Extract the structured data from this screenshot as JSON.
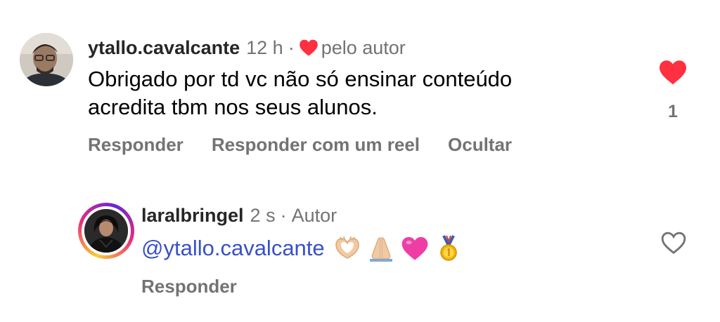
{
  "comment": {
    "username": "ytallo.cavalcante",
    "time": "12 h",
    "separator": "·",
    "liked_by_author_label": "pelo autor",
    "text_line1": "Obrigado por td vc não só ensinar conteúdo",
    "text_line2": "acredita tbm nos seus alunos.",
    "like_count": "1",
    "liked": true,
    "actions": {
      "reply": "Responder",
      "reply_with_reel": "Responder com um reel",
      "hide": "Ocultar"
    }
  },
  "reply": {
    "username": "laralbringel",
    "time": "2 s",
    "separator": "·",
    "badge": "Autor",
    "mention": "@ytallo.cavalcante",
    "emojis": [
      "heart-hands-emoji",
      "folded-hands-emoji",
      "pink-heart-emoji",
      "medal-emoji"
    ],
    "liked": false,
    "actions": {
      "reply": "Responder"
    }
  },
  "colors": {
    "like_red": "#ff3040",
    "mention_blue": "#3850c8",
    "muted_gray": "#737373",
    "story_ring": [
      "#f9ce34",
      "#ee2a7b",
      "#6228d7"
    ]
  }
}
